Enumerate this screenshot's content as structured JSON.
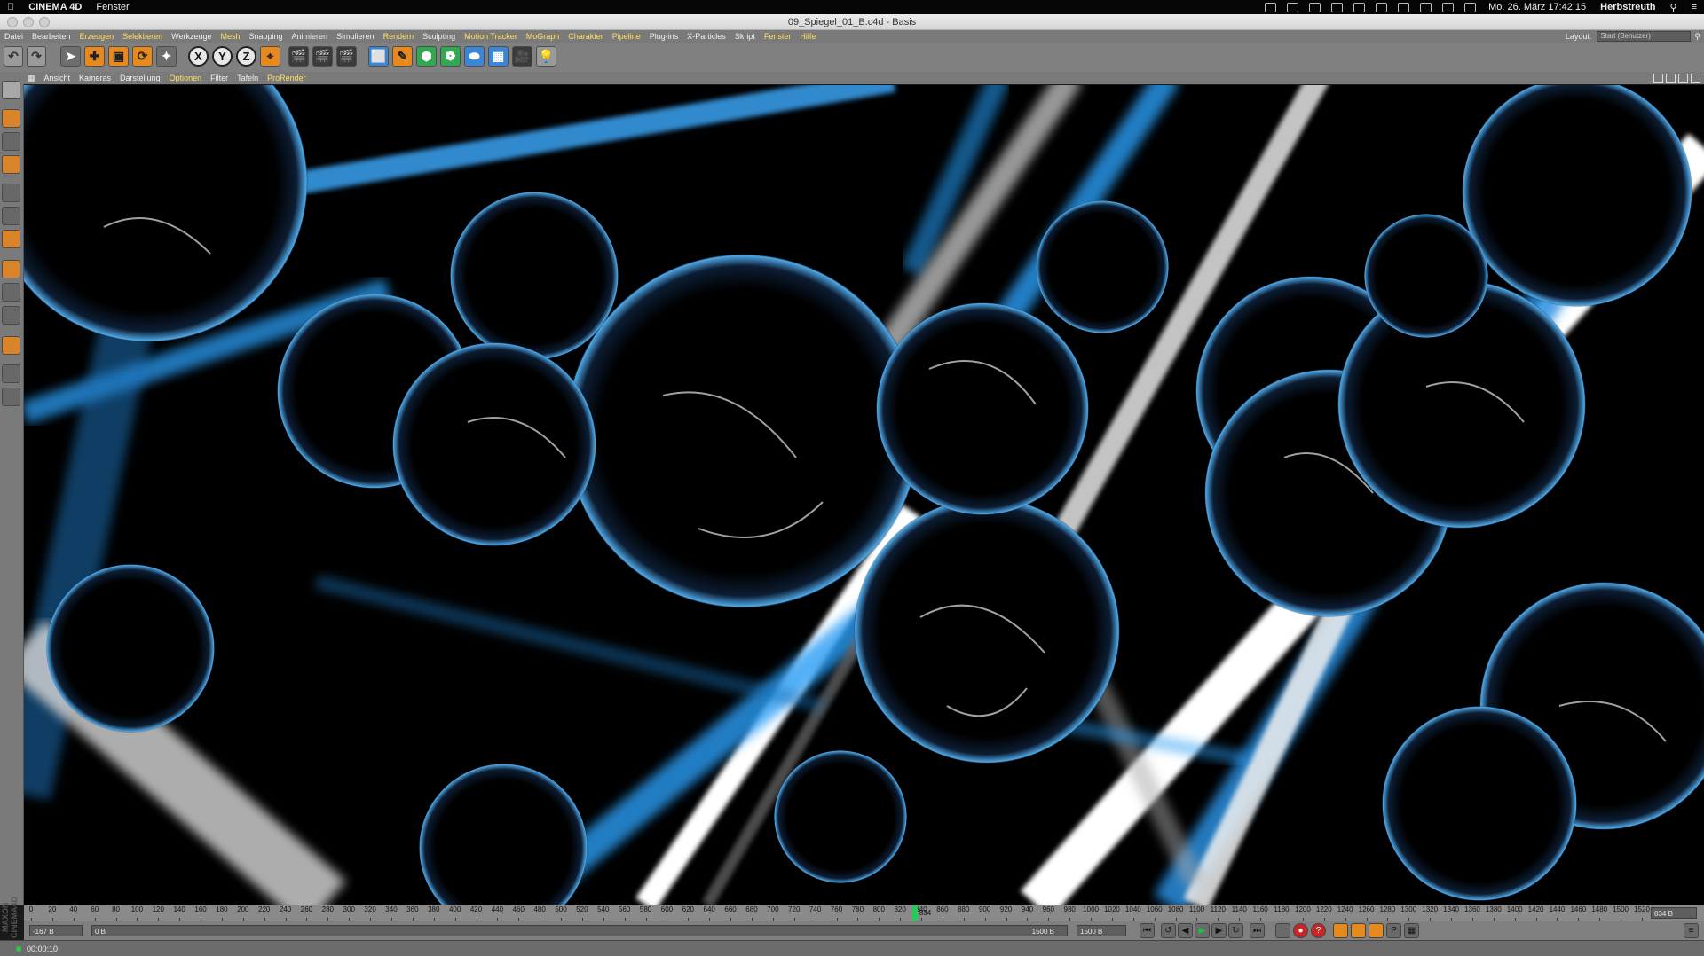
{
  "mac_menu": {
    "app_name": "CINEMA 4D",
    "items": [
      "Fenster"
    ],
    "clock": "Mo. 26. März  17:42:15",
    "user": "Herbstreuth"
  },
  "window": {
    "title": "09_Spiegel_01_B.c4d - Basis"
  },
  "app_menu": {
    "items": [
      {
        "label": "Datei",
        "highlight": false
      },
      {
        "label": "Bearbeiten",
        "highlight": false
      },
      {
        "label": "Erzeugen",
        "highlight": true
      },
      {
        "label": "Selektieren",
        "highlight": true
      },
      {
        "label": "Werkzeuge",
        "highlight": false
      },
      {
        "label": "Mesh",
        "highlight": true
      },
      {
        "label": "Snapping",
        "highlight": false
      },
      {
        "label": "Animieren",
        "highlight": false
      },
      {
        "label": "Simulieren",
        "highlight": false
      },
      {
        "label": "Rendern",
        "highlight": true
      },
      {
        "label": "Sculpting",
        "highlight": false
      },
      {
        "label": "Motion Tracker",
        "highlight": true
      },
      {
        "label": "MoGraph",
        "highlight": true
      },
      {
        "label": "Charakter",
        "highlight": true
      },
      {
        "label": "Pipeline",
        "highlight": true
      },
      {
        "label": "Plug-ins",
        "highlight": false
      },
      {
        "label": "X-Particles",
        "highlight": false
      },
      {
        "label": "Skript",
        "highlight": false
      },
      {
        "label": "Fenster",
        "highlight": true
      },
      {
        "label": "Hilfe",
        "highlight": true
      }
    ],
    "layout_label": "Layout:",
    "layout_value": "Start (Benutzer)"
  },
  "toolbar": {
    "axis_x": "X",
    "axis_y": "Y",
    "axis_z": "Z"
  },
  "view_menu": {
    "items": [
      {
        "label": "Ansicht",
        "highlight": false
      },
      {
        "label": "Kameras",
        "highlight": false
      },
      {
        "label": "Darstellung",
        "highlight": false
      },
      {
        "label": "Optionen",
        "highlight": true
      },
      {
        "label": "Filter",
        "highlight": false
      },
      {
        "label": "Tafeln",
        "highlight": false
      },
      {
        "label": "ProRender",
        "highlight": true
      }
    ]
  },
  "branding": {
    "logo_text": "MAXON CINEMA4D"
  },
  "timeline": {
    "start": 0,
    "end": 1520,
    "step": 20,
    "current_frame": 834,
    "current_label": "834",
    "end_field": "834 B"
  },
  "transport": {
    "start_field": "-167 B",
    "preview_min": "0 B",
    "preview_max": "1500 B",
    "end_field": "1500 B"
  },
  "status": {
    "time": "00:00:10"
  },
  "colors": {
    "accent_highlight": "#ffe066",
    "timeline_cursor": "#22cc55",
    "beam_blue": "#2a9df4"
  }
}
